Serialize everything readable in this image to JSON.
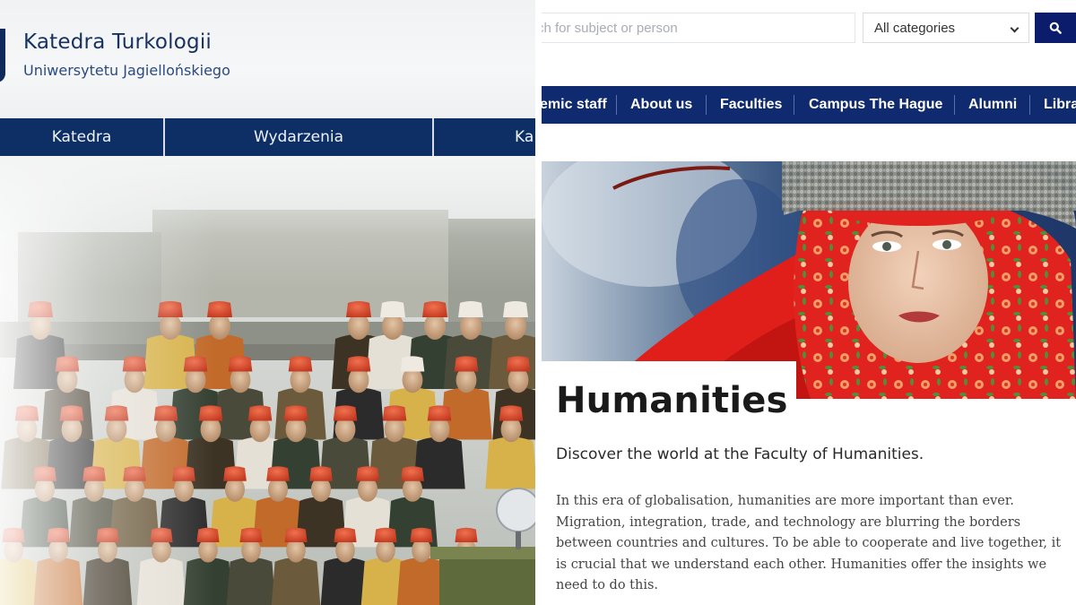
{
  "left_site": {
    "dept_title": "Katedra Turkologii",
    "university": "Uniwersytetu Jagiellońskiego",
    "nav": [
      "Katedra",
      "Wydarzenia",
      "Ka"
    ],
    "photo": "historic-group-photo"
  },
  "right_site": {
    "search": {
      "placeholder": "rch for subject or person",
      "category_value": "All categories",
      "category_options": [
        "All categories"
      ],
      "button_icon": "search-icon"
    },
    "nav": [
      "emic staff",
      "About us",
      "Faculties",
      "Campus The Hague",
      "Alumni",
      "Libra"
    ],
    "hero_image": "woman-in-red-scarf-photo",
    "title": "Humanities",
    "subtitle": "Discover the world at the Faculty of Humanities.",
    "body_lines": [
      "In this era of globalisation, humanities are more important than ever.",
      "Migration, integration, trade, and technology are blurring the borders",
      "between countries and cultures. To be able to cooperate and live together, it",
      "is crucial that we understand each other. Humanities offer the insights we",
      "need to do this."
    ]
  },
  "colors": {
    "left_nav_bg": "#0d2f66",
    "left_title": "#17325e",
    "right_nav_bg": "#0f2a6e",
    "search_button_bg": "#0a1c6b",
    "fez_red": "#d9482f",
    "scarf_red": "#e0231e"
  }
}
